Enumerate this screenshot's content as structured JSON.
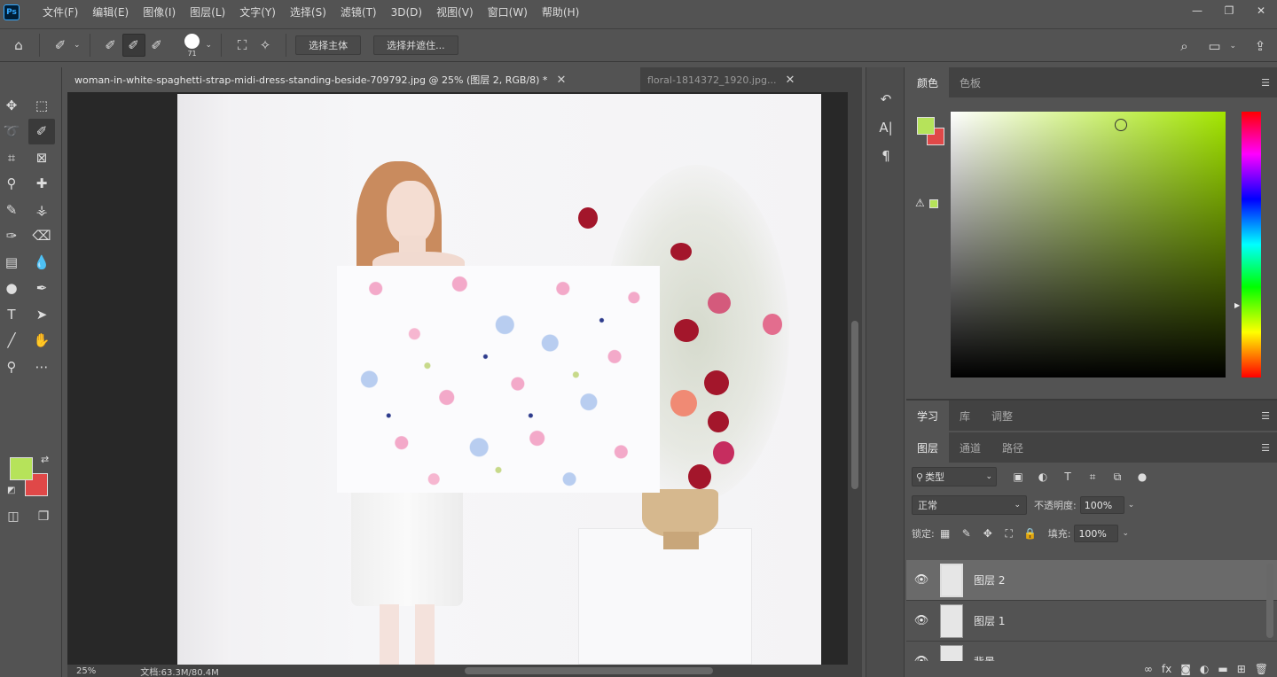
{
  "app": {
    "logo": "Ps",
    "menus": [
      "文件(F)",
      "编辑(E)",
      "图像(I)",
      "图层(L)",
      "文字(Y)",
      "选择(S)",
      "滤镜(T)",
      "3D(D)",
      "视图(V)",
      "窗口(W)",
      "帮助(H)"
    ],
    "window_controls": [
      "minimize-icon",
      "restore-icon",
      "close-icon"
    ]
  },
  "options_bar": {
    "brush_size": "71",
    "select_subject_label": "选择主体",
    "select_and_mask_label": "选择并遮住..."
  },
  "tabs": [
    {
      "label": "woman-in-white-spaghetti-strap-midi-dress-standing-beside-709792.jpg  @  25%  (图层 2, RGB/8) *",
      "active": true
    },
    {
      "label": "floral-1814372_1920.jpg...",
      "active": false
    }
  ],
  "status": {
    "zoom": "25%",
    "doc_size": "文档:63.3M/80.4M"
  },
  "colors": {
    "foreground": "#b6e35a",
    "background": "#e04848",
    "accent": "#31a8ff"
  },
  "color_panel": {
    "tabs": [
      "颜色",
      "色板"
    ]
  },
  "learn_panel": {
    "tabs": [
      "学习",
      "库",
      "调整"
    ]
  },
  "layers_panel": {
    "tabs": [
      "图层",
      "通道",
      "路径"
    ],
    "filter_label": "类型",
    "blend_mode": "正常",
    "opacity_label": "不透明度:",
    "opacity_value": "100%",
    "lock_label": "锁定:",
    "fill_label": "填充:",
    "fill_value": "100%",
    "layers": [
      {
        "name": "图层 2",
        "selected": true
      },
      {
        "name": "图层 1",
        "selected": false
      },
      {
        "name": "背景",
        "selected": false
      }
    ]
  }
}
